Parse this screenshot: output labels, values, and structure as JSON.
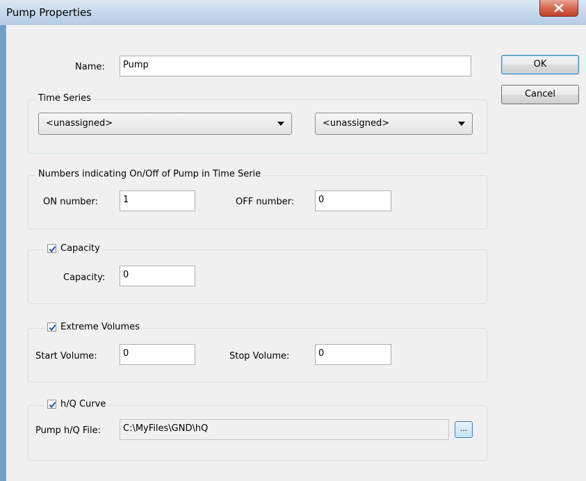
{
  "window": {
    "title": "Pump Properties"
  },
  "name_row": {
    "label": "Name:",
    "value": "Pump"
  },
  "buttons": {
    "ok": "OK",
    "cancel": "Cancel"
  },
  "time_series": {
    "title": "Time Series",
    "select1": "<unassigned>",
    "select2": "<unassigned>"
  },
  "on_off": {
    "title": "Numbers indicating On/Off of Pump in Time Serie",
    "on_label": "ON number:",
    "on_value": "1",
    "off_label": "OFF number:",
    "off_value": "0"
  },
  "capacity": {
    "title": "Capacity",
    "checked": true,
    "label": "Capacity:",
    "value": "0"
  },
  "extreme": {
    "title": "Extreme Volumes",
    "checked": true,
    "start_label": "Start Volume:",
    "start_value": "0",
    "stop_label": "Stop Volume:",
    "stop_value": "0"
  },
  "hq": {
    "title": "h/Q Curve",
    "checked": true,
    "label": "Pump h/Q File:",
    "value": "C:\\MyFiles\\GND\\hQ",
    "browse_label": "..."
  }
}
